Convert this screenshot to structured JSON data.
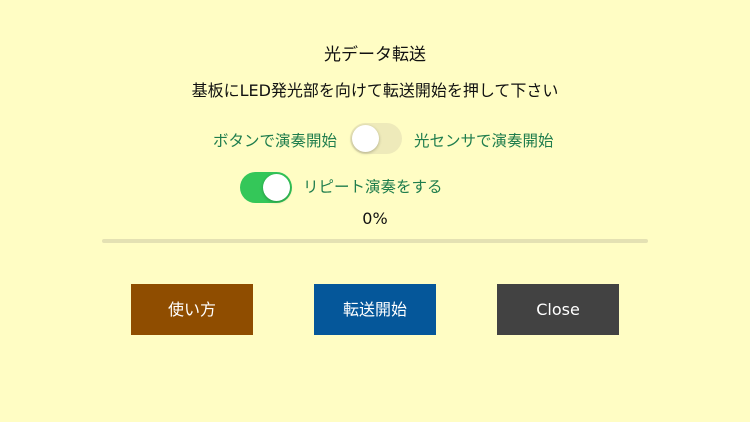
{
  "dialog": {
    "title": "光データ転送",
    "instruction": "基板にLED発光部を向けて転送開始を押して下さい"
  },
  "mode_toggle": {
    "left_label": "ボタンで演奏開始",
    "right_label": "光センサで演奏開始",
    "state": "off"
  },
  "repeat_toggle": {
    "label": "リピート演奏をする",
    "state": "on"
  },
  "progress": {
    "label": "0%",
    "value": 0
  },
  "buttons": {
    "howto_label": "使い方",
    "start_label": "転送開始",
    "close_label": "Close"
  },
  "colors": {
    "background": "#fffdc4",
    "label_green": "#1f7d4d",
    "switch_on": "#34c759",
    "howto_button": "#8f4d00",
    "start_button": "#05579a",
    "close_button": "#424242"
  }
}
